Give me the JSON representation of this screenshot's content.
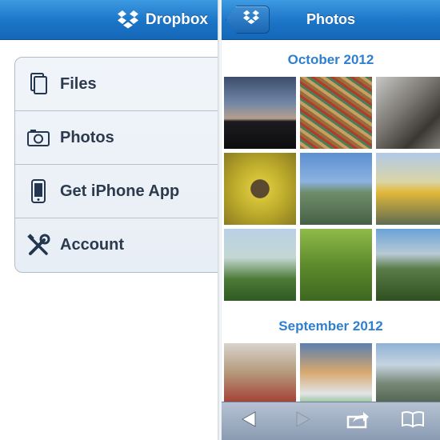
{
  "left_panel": {
    "brand_name": "Dropbox",
    "brand_icon": "dropbox-logo-icon",
    "menu": [
      {
        "label": "Files",
        "icon": "files-icon"
      },
      {
        "label": "Photos",
        "icon": "camera-icon"
      },
      {
        "label": "Get iPhone App",
        "icon": "iphone-icon"
      },
      {
        "label": "Account",
        "icon": "tools-icon"
      }
    ]
  },
  "right_panel": {
    "title": "Photos",
    "back_button_icon": "dropbox-logo-icon",
    "sections": [
      {
        "month": "October 2012",
        "photo_count_visible": 9
      },
      {
        "month": "September 2012",
        "photo_count_visible": 3
      }
    ],
    "toolbar": {
      "buttons": [
        "back-arrow-icon",
        "forward-arrow-icon",
        "share-icon",
        "bookmarks-icon"
      ]
    }
  },
  "colors": {
    "nav_bar": "#1b74c7",
    "month_header": "#2f7fd0",
    "menu_text": "#2b3a4d",
    "toolbar": "#8a9bb2"
  }
}
